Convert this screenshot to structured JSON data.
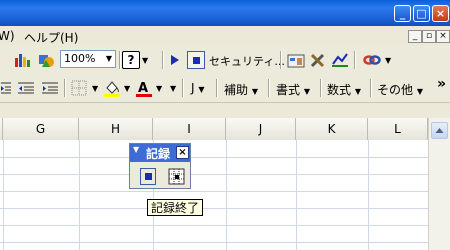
{
  "window": {
    "minimize_glyph": "_",
    "maximize_glyph": "□",
    "close_glyph": "×"
  },
  "menubar": {
    "items": [
      "W)",
      "ヘルプ(H)"
    ],
    "doc_minimize_glyph": "_",
    "doc_restore_glyph": "▫",
    "doc_close_glyph": "×"
  },
  "toolbar_standard": {
    "zoom_value": "100%",
    "help_glyph": "?",
    "security_label": "セキュリティ..."
  },
  "toolbar_format": {
    "j_label": "J",
    "help_menu_label": "補助",
    "format_menu_label": "書式",
    "formula_menu_label": "数式",
    "other_menu_label": "その他",
    "overflow_glyph": "»"
  },
  "sheet": {
    "columns": [
      "G",
      "H",
      "I",
      "J",
      "K",
      "L"
    ]
  },
  "recording_toolbar": {
    "title": "記録",
    "close_glyph": "×",
    "tooltip": "記録終了"
  },
  "colors": {
    "titlebar": "#0a5fd8",
    "toolbar_bg": "#ebeadb",
    "gridline": "#d0d7e5",
    "record_title_bg": "#3d6cd5"
  }
}
